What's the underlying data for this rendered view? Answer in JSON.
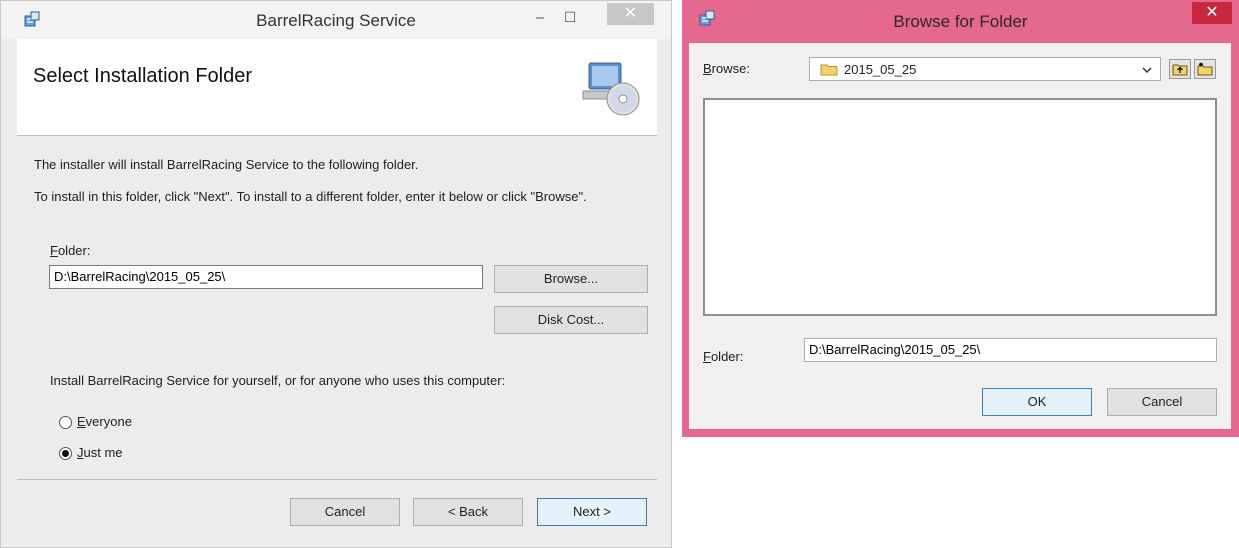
{
  "installer": {
    "title": "BarrelRacing Service",
    "controls": {
      "minimize": "–",
      "maximize": "☐",
      "close": "✕"
    },
    "heading": "Select Installation Folder",
    "intro_line1": "The installer will install BarrelRacing Service to the following folder.",
    "intro_line2": "To install in this folder, click \"Next\". To install to a different folder, enter it below or click \"Browse\".",
    "folder_label_accel": "F",
    "folder_label_rest": "older:",
    "folder_value": "D:\\BarrelRacing\\2015_05_25\\",
    "browse_button": "Browse...",
    "disk_cost_button": "Disk Cost...",
    "scope_question": "Install BarrelRacing Service for yourself, or for anyone who uses this computer:",
    "option_everyone_accel": "E",
    "option_everyone_rest": "veryone",
    "option_justme_accel": "J",
    "option_justme_rest": "ust me",
    "selected_option": "Just me",
    "cancel_button": "Cancel",
    "back_button": "< Back",
    "next_button": "Next >"
  },
  "browse_dialog": {
    "title": "Browse for Folder",
    "close": "✕",
    "browse_label_accel": "B",
    "browse_label_rest": "rowse:",
    "current_folder": "2015_05_25",
    "folder_label_accel": "F",
    "folder_label_rest": "older:",
    "folder_value": "D:\\BarrelRacing\\2015_05_25\\",
    "ok_button": "OK",
    "cancel_button": "Cancel",
    "accent_color": "#e6688f"
  }
}
